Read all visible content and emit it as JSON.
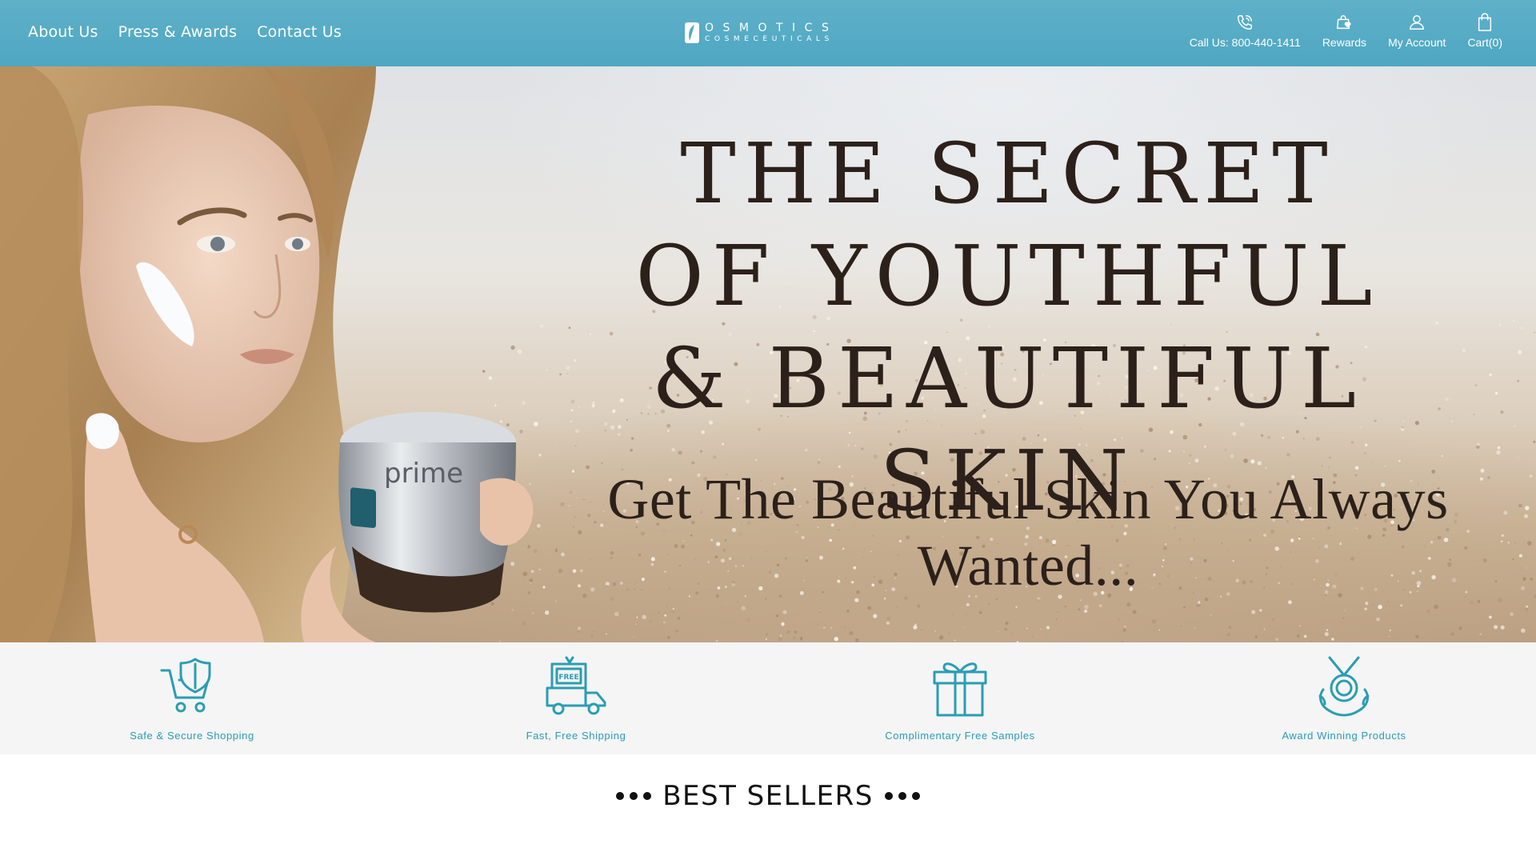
{
  "header": {
    "nav_links": [
      {
        "label": "About Us"
      },
      {
        "label": "Press & Awards"
      },
      {
        "label": "Contact Us"
      }
    ],
    "logo": {
      "line1": "OSMOTICS",
      "line2": "COSMECEUTICALS"
    },
    "utility": [
      {
        "icon": "phone-icon",
        "label": "Call Us: 800-440-1411"
      },
      {
        "icon": "rewards-bag-icon",
        "label": "Rewards"
      },
      {
        "icon": "user-icon",
        "label": "My Account"
      },
      {
        "icon": "shopping-bag-icon",
        "label": "Cart(0)"
      }
    ],
    "bar_color": "#55abc5"
  },
  "hero": {
    "title_lines": [
      "THE SECRET",
      "OF YOUTHFUL",
      "& BEAUTIFUL SKIN"
    ],
    "subtitle": "Get The Beautiful Skin You Always Wanted...",
    "jar_label": "prime"
  },
  "features": [
    {
      "icon": "secure-cart-shield-icon",
      "label": "Safe & Secure Shopping"
    },
    {
      "icon": "free-shipping-truck-icon",
      "label": "Fast, Free Shipping",
      "badge": "FREE"
    },
    {
      "icon": "gift-box-icon",
      "label": "Complimentary Free Samples"
    },
    {
      "icon": "award-medal-icon",
      "label": "Award Winning Products"
    }
  ],
  "best_sellers": {
    "title": "BEST SELLERS"
  },
  "colors": {
    "accent": "#2a9db3",
    "text_dark": "#2c201a"
  }
}
